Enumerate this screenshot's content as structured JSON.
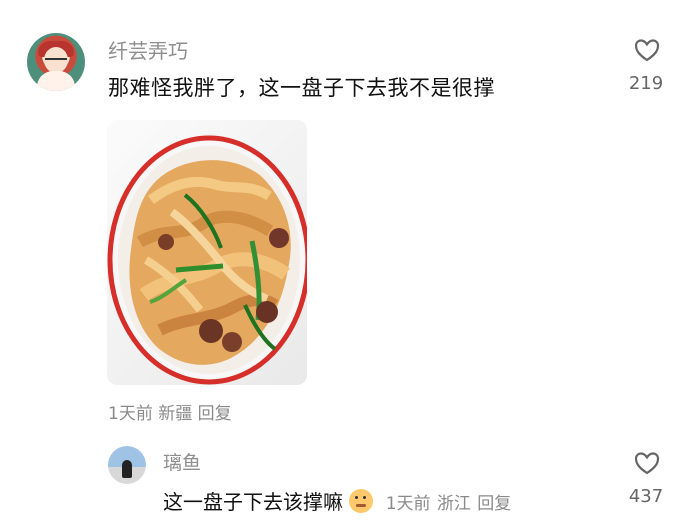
{
  "comment": {
    "username": "纤芸弄巧",
    "text": "那难怪我胖了，这一盘子下去我不是很撑",
    "like_count": "219",
    "meta": {
      "time": "1天前",
      "location": "新疆",
      "reply": "回复"
    },
    "icons": {
      "avatar": "avatar-cartoon-girl",
      "like": "heart-icon"
    }
  },
  "reply": {
    "username": "璃鱼",
    "text": "这一盘子下去该撑嘛",
    "emoji": "thinking-face-emoji",
    "meta": {
      "time": "1天前",
      "location": "浙江",
      "reply": "回复"
    },
    "like_count": "437",
    "icons": {
      "avatar": "avatar-beach-person",
      "like": "heart-icon"
    }
  },
  "colors": {
    "text": "#111111",
    "muted": "#8a8a8a",
    "background": "#ffffff"
  }
}
